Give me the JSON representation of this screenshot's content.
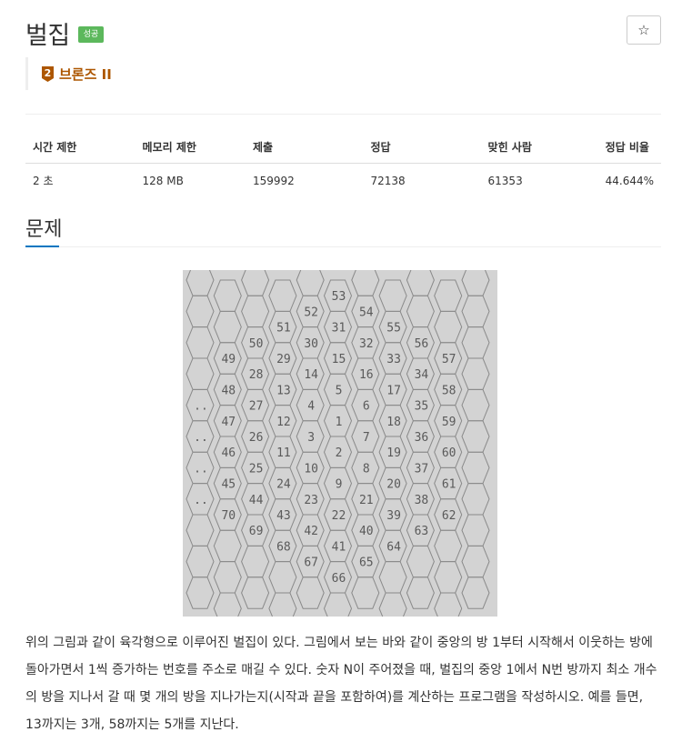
{
  "header": {
    "title": "벌집",
    "result_badge": "성공",
    "star_icon": "star-icon",
    "star_glyph": "☆"
  },
  "tier": {
    "icon": "bronze-tier-icon",
    "icon_number": "2",
    "label": "브론즈 II",
    "color": "#ad5600"
  },
  "info_table": {
    "headers": [
      "시간 제한",
      "메모리 제한",
      "제출",
      "정답",
      "맞힌 사람",
      "정답 비율"
    ],
    "values": [
      "2 초",
      "128 MB",
      "159992",
      "72138",
      "61353",
      "44.644%"
    ]
  },
  "section": {
    "title": "문제"
  },
  "figure": {
    "numbers": [
      {
        "n": "53",
        "c": 5,
        "r": 1
      },
      {
        "n": "52",
        "c": 4,
        "r": 2
      },
      {
        "n": "54",
        "c": 6,
        "r": 2
      },
      {
        "n": "51",
        "c": 3,
        "r": 3
      },
      {
        "n": "31",
        "c": 5,
        "r": 3
      },
      {
        "n": "55",
        "c": 7,
        "r": 3
      },
      {
        "n": "50",
        "c": 2,
        "r": 4
      },
      {
        "n": "30",
        "c": 4,
        "r": 4
      },
      {
        "n": "32",
        "c": 6,
        "r": 4
      },
      {
        "n": "56",
        "c": 8,
        "r": 4
      },
      {
        "n": "49",
        "c": 1,
        "r": 5
      },
      {
        "n": "29",
        "c": 3,
        "r": 5
      },
      {
        "n": "15",
        "c": 5,
        "r": 5
      },
      {
        "n": "33",
        "c": 7,
        "r": 5
      },
      {
        "n": "57",
        "c": 9,
        "r": 5
      },
      {
        "n": "28",
        "c": 2,
        "r": 6
      },
      {
        "n": "14",
        "c": 4,
        "r": 6
      },
      {
        "n": "16",
        "c": 6,
        "r": 6
      },
      {
        "n": "34",
        "c": 8,
        "r": 6
      },
      {
        "n": "48",
        "c": 1,
        "r": 7
      },
      {
        "n": "13",
        "c": 3,
        "r": 7
      },
      {
        "n": "5",
        "c": 5,
        "r": 7
      },
      {
        "n": "17",
        "c": 7,
        "r": 7
      },
      {
        "n": "58",
        "c": 9,
        "r": 7
      },
      {
        "n": "..",
        "c": 0,
        "r": 8
      },
      {
        "n": "27",
        "c": 2,
        "r": 8
      },
      {
        "n": "4",
        "c": 4,
        "r": 8
      },
      {
        "n": "6",
        "c": 6,
        "r": 8
      },
      {
        "n": "35",
        "c": 8,
        "r": 8
      },
      {
        "n": "47",
        "c": 1,
        "r": 9
      },
      {
        "n": "12",
        "c": 3,
        "r": 9
      },
      {
        "n": "1",
        "c": 5,
        "r": 9
      },
      {
        "n": "18",
        "c": 7,
        "r": 9
      },
      {
        "n": "59",
        "c": 9,
        "r": 9
      },
      {
        "n": "..",
        "c": 0,
        "r": 10
      },
      {
        "n": "26",
        "c": 2,
        "r": 10
      },
      {
        "n": "3",
        "c": 4,
        "r": 10
      },
      {
        "n": "7",
        "c": 6,
        "r": 10
      },
      {
        "n": "36",
        "c": 8,
        "r": 10
      },
      {
        "n": "46",
        "c": 1,
        "r": 11
      },
      {
        "n": "11",
        "c": 3,
        "r": 11
      },
      {
        "n": "2",
        "c": 5,
        "r": 11
      },
      {
        "n": "19",
        "c": 7,
        "r": 11
      },
      {
        "n": "60",
        "c": 9,
        "r": 11
      },
      {
        "n": "..",
        "c": 0,
        "r": 12
      },
      {
        "n": "25",
        "c": 2,
        "r": 12
      },
      {
        "n": "10",
        "c": 4,
        "r": 12
      },
      {
        "n": "8",
        "c": 6,
        "r": 12
      },
      {
        "n": "37",
        "c": 8,
        "r": 12
      },
      {
        "n": "45",
        "c": 1,
        "r": 13
      },
      {
        "n": "24",
        "c": 3,
        "r": 13
      },
      {
        "n": "9",
        "c": 5,
        "r": 13
      },
      {
        "n": "20",
        "c": 7,
        "r": 13
      },
      {
        "n": "61",
        "c": 9,
        "r": 13
      },
      {
        "n": "..",
        "c": 0,
        "r": 14
      },
      {
        "n": "44",
        "c": 2,
        "r": 14
      },
      {
        "n": "23",
        "c": 4,
        "r": 14
      },
      {
        "n": "21",
        "c": 6,
        "r": 14
      },
      {
        "n": "38",
        "c": 8,
        "r": 14
      },
      {
        "n": "70",
        "c": 1,
        "r": 15
      },
      {
        "n": "43",
        "c": 3,
        "r": 15
      },
      {
        "n": "22",
        "c": 5,
        "r": 15
      },
      {
        "n": "39",
        "c": 7,
        "r": 15
      },
      {
        "n": "62",
        "c": 9,
        "r": 15
      },
      {
        "n": "69",
        "c": 2,
        "r": 16
      },
      {
        "n": "42",
        "c": 4,
        "r": 16
      },
      {
        "n": "40",
        "c": 6,
        "r": 16
      },
      {
        "n": "63",
        "c": 8,
        "r": 16
      },
      {
        "n": "68",
        "c": 3,
        "r": 17
      },
      {
        "n": "41",
        "c": 5,
        "r": 17
      },
      {
        "n": "64",
        "c": 7,
        "r": 17
      },
      {
        "n": "67",
        "c": 4,
        "r": 18
      },
      {
        "n": "65",
        "c": 6,
        "r": 18
      },
      {
        "n": "66",
        "c": 5,
        "r": 19
      }
    ]
  },
  "description": "위의 그림과 같이 육각형으로 이루어진 벌집이 있다. 그림에서 보는 바와 같이 중앙의 방 1부터 시작해서 이웃하는 방에 돌아가면서 1씩 증가하는 번호를 주소로 매길 수 있다. 숫자 N이 주어졌을 때, 벌집의 중앙 1에서 N번 방까지 최소 개수의 방을 지나서 갈 때 몇 개의 방을 지나가는지(시작과 끝을 포함하여)를 계산하는 프로그램을 작성하시오. 예를 들면, 13까지는 3개, 58까지는 5개를 지난다."
}
